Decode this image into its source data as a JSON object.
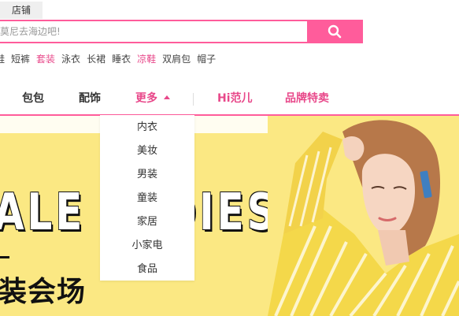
{
  "header": {
    "shop_tab": "店铺",
    "search": {
      "placeholder": "莫尼去海边吧!"
    },
    "hot_words": [
      {
        "text": "鞋",
        "highlight": false
      },
      {
        "text": "短裤",
        "highlight": false
      },
      {
        "text": "套装",
        "highlight": true
      },
      {
        "text": "泳衣",
        "highlight": false
      },
      {
        "text": "长裙",
        "highlight": false
      },
      {
        "text": "睡衣",
        "highlight": false
      },
      {
        "text": "凉鞋",
        "highlight": true
      },
      {
        "text": "双肩包",
        "highlight": false
      },
      {
        "text": "帽子",
        "highlight": false
      }
    ]
  },
  "nav": {
    "bags": "包包",
    "accessories": "配饰",
    "more": "更多",
    "hi_fan": "Hi范儿",
    "brand_sale": "品牌特卖"
  },
  "more_menu": [
    "内衣",
    "美妆",
    "男装",
    "童装",
    "家居",
    "小家电",
    "食品"
  ],
  "banner": {
    "headline": "ALE LADIES",
    "subtitle": "装会场"
  },
  "colors": {
    "accent": "#ff5c9b",
    "link_highlight": "#e8488a",
    "banner_bg": "#fbe883"
  }
}
